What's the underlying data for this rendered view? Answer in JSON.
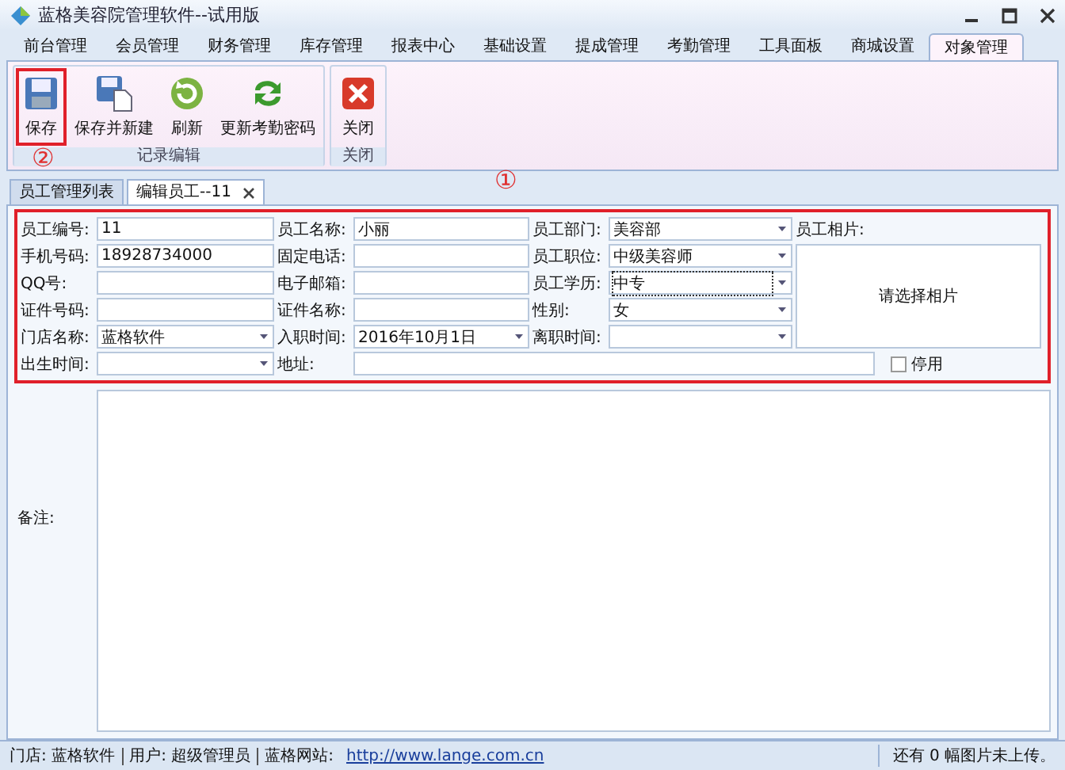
{
  "window": {
    "title": "蓝格美容院管理软件--试用版"
  },
  "tabs": [
    {
      "label": "前台管理",
      "selected": false
    },
    {
      "label": "会员管理",
      "selected": false
    },
    {
      "label": "财务管理",
      "selected": false
    },
    {
      "label": "库存管理",
      "selected": false
    },
    {
      "label": "报表中心",
      "selected": false
    },
    {
      "label": "基础设置",
      "selected": false
    },
    {
      "label": "提成管理",
      "selected": false
    },
    {
      "label": "考勤管理",
      "selected": false
    },
    {
      "label": "工具面板",
      "selected": false
    },
    {
      "label": "商城设置",
      "selected": false
    },
    {
      "label": "对象管理",
      "selected": true
    }
  ],
  "ribbon_groups": [
    {
      "title": "记录编辑",
      "buttons": [
        {
          "label": "保存",
          "kind": "save",
          "marked": true
        },
        {
          "label": "保存并新建",
          "kind": "save-new",
          "marked": false
        },
        {
          "label": "刷新",
          "kind": "refresh",
          "marked": false
        },
        {
          "label": "更新考勤密码",
          "kind": "update",
          "marked": false
        }
      ]
    },
    {
      "title": "关闭",
      "buttons": [
        {
          "label": "关闭",
          "kind": "close",
          "marked": false
        }
      ]
    }
  ],
  "annotations": [
    "②",
    "①"
  ],
  "doc_tabs": [
    {
      "label": "员工管理列表",
      "selected": false,
      "closable": false
    },
    {
      "label": "编辑员工--11",
      "selected": true,
      "closable": true
    }
  ],
  "form": {
    "rows": [
      [
        {
          "label": "员工编号:",
          "value": "11",
          "kind": "text"
        },
        {
          "label": "员工名称:",
          "value": "小丽",
          "kind": "text"
        },
        {
          "label": "员工部门:",
          "value": "美容部",
          "kind": "select"
        }
      ],
      [
        {
          "label": "手机号码:",
          "value": "18928734000",
          "kind": "text"
        },
        {
          "label": "固定电话:",
          "kind": "text"
        },
        {
          "label": "员工职位:",
          "value": "中级美容师",
          "kind": "select"
        }
      ],
      [
        {
          "label": "QQ号:",
          "kind": "text"
        },
        {
          "label": "电子邮箱:",
          "kind": "text"
        },
        {
          "label": "员工学历:",
          "value": "中专",
          "kind": "select",
          "focused": true
        }
      ],
      [
        {
          "label": "证件号码:",
          "kind": "text"
        },
        {
          "label": "证件名称:",
          "kind": "text"
        },
        {
          "label": "性别:",
          "value": "女",
          "kind": "select"
        }
      ],
      [
        {
          "label": "门店名称:",
          "value": "蓝格软件",
          "kind": "select"
        },
        {
          "label": "入职时间:",
          "value": "2016年10月1日",
          "kind": "select"
        },
        {
          "label": "离职时间:",
          "kind": "select"
        }
      ]
    ],
    "photo_label": "员工相片:",
    "photo_hint": "请选择相片",
    "birth": {
      "label": "出生时间:",
      "kind": "select"
    },
    "address": {
      "label": "地址:"
    },
    "disabled_box": {
      "label": "停用",
      "checked": false
    }
  },
  "remarks": {
    "label": "备注:"
  },
  "status_bar": {
    "items": [
      "门店: 蓝格软件",
      "用户: 超级管理员",
      "蓝格网站:"
    ],
    "link": "http://www.lange.com.cn",
    "right": "还有 0 幅图片未上传。"
  }
}
